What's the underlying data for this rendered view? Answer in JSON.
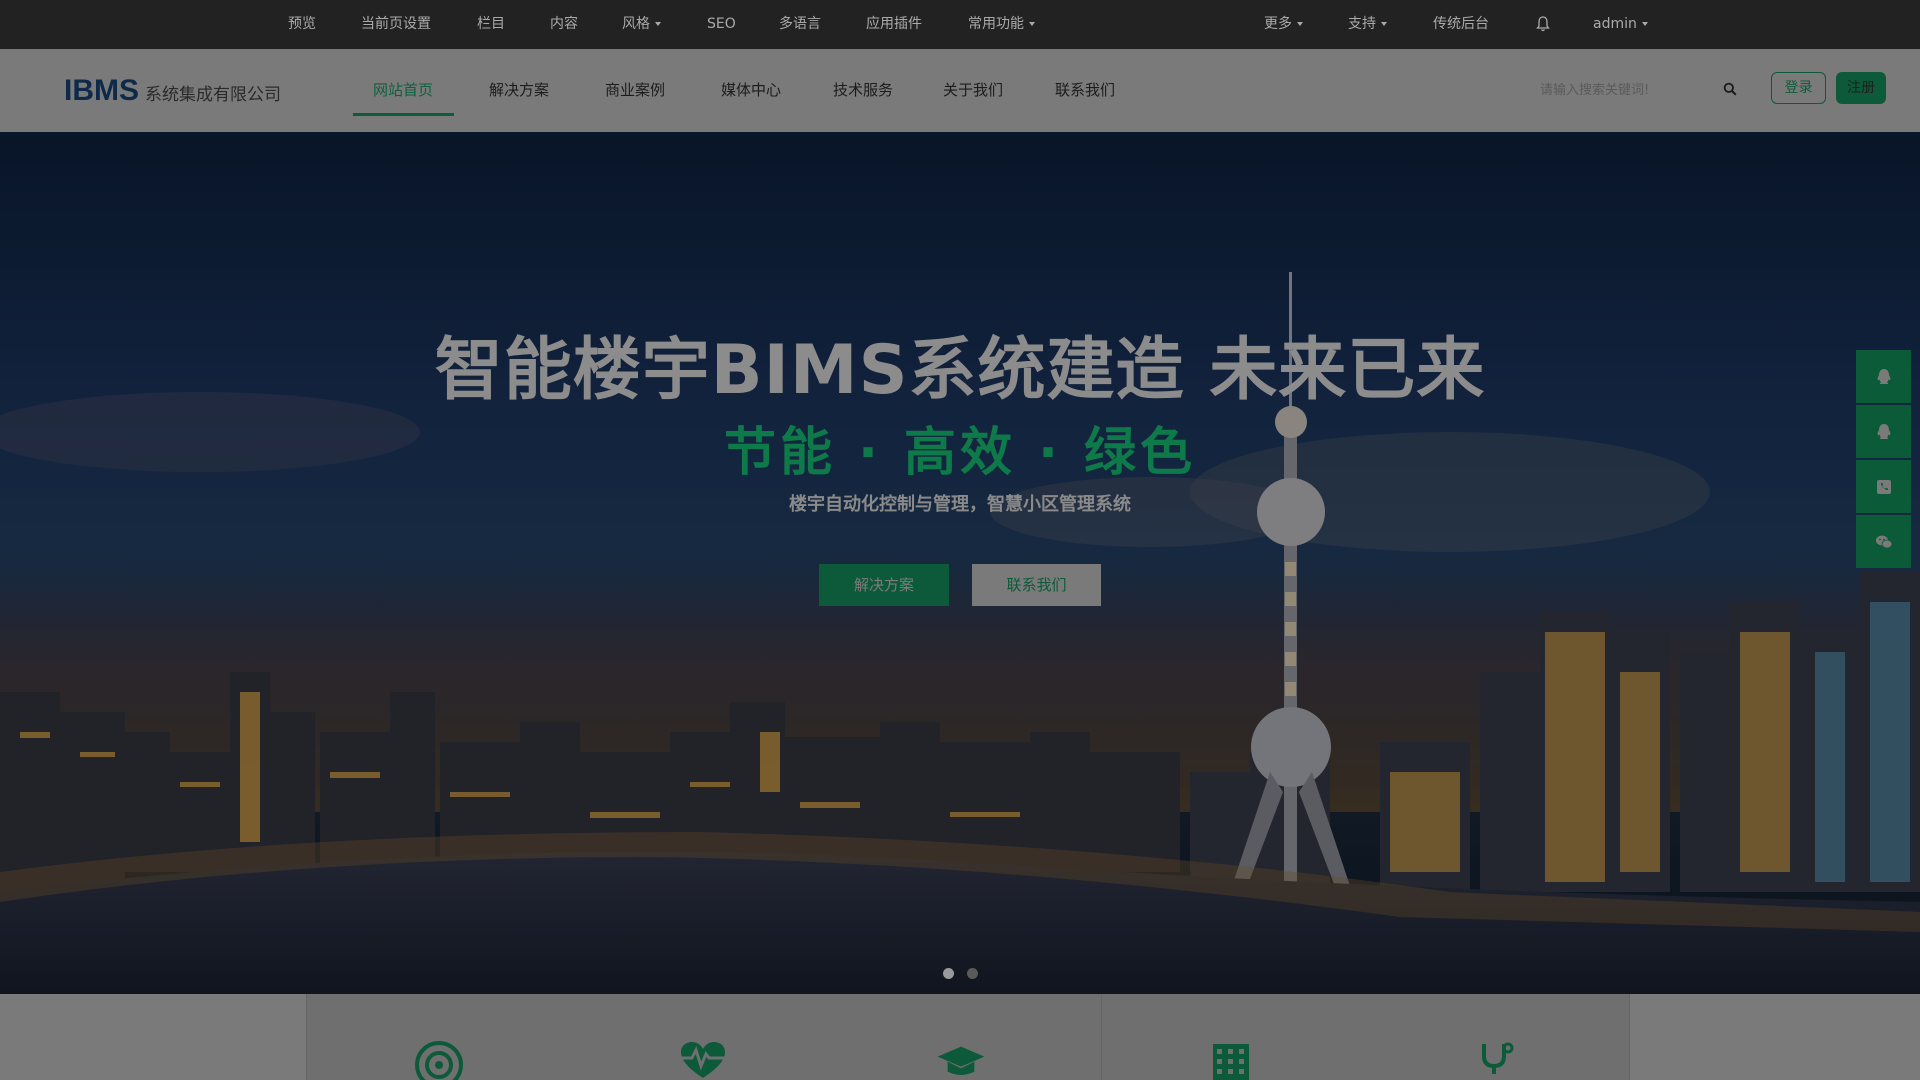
{
  "admin_bar": {
    "left_items": [
      {
        "label": "预览",
        "caret": false
      },
      {
        "label": "当前页设置",
        "caret": false
      },
      {
        "label": "栏目",
        "caret": false
      },
      {
        "label": "内容",
        "caret": false
      },
      {
        "label": "风格",
        "caret": true
      },
      {
        "label": "SEO",
        "caret": false
      },
      {
        "label": "多语言",
        "caret": false
      },
      {
        "label": "应用插件",
        "caret": false
      },
      {
        "label": "常用功能",
        "caret": true
      }
    ],
    "right_items": [
      {
        "label": "更多",
        "caret": true
      },
      {
        "label": "支持",
        "caret": true
      },
      {
        "label": "传统后台",
        "caret": false
      }
    ],
    "bell_icon": "bell-icon",
    "user_label": "admin"
  },
  "header": {
    "logo_mark": "IBMS",
    "logo_name": "系统集成有限公司",
    "nav": [
      {
        "label": "网站首页",
        "active": true
      },
      {
        "label": "解决方案",
        "active": false
      },
      {
        "label": "商业案例",
        "active": false
      },
      {
        "label": "媒体中心",
        "active": false
      },
      {
        "label": "技术服务",
        "active": false
      },
      {
        "label": "关于我们",
        "active": false
      },
      {
        "label": "联系我们",
        "active": false
      }
    ],
    "search_placeholder": "请输入搜索关键词!",
    "search_icon": "search-icon",
    "login_label": "登录",
    "register_label": "注册"
  },
  "hero": {
    "title": "智能楼宇BIMS系统建造 未来已来",
    "subtitle": "节能 · 高效 · 绿色",
    "description": "楼宇自动化控制与管理，智慧小区管理系统",
    "primary_button": "解决方案",
    "secondary_button": "联系我们",
    "carousel": {
      "count": 2,
      "active_index": 0
    }
  },
  "floating_sidebar": [
    "qq-icon",
    "qq-icon",
    "phone-icon",
    "wechat-icon"
  ],
  "feature_icons": [
    "target-icon",
    "heart-pulse-icon",
    "graduation-cap-icon",
    "building-icon",
    "stethoscope-icon"
  ],
  "colors": {
    "brand_green": "#0c5a39",
    "admin_bar_bg": "#222222",
    "header_bg": "#7a7a7a"
  }
}
